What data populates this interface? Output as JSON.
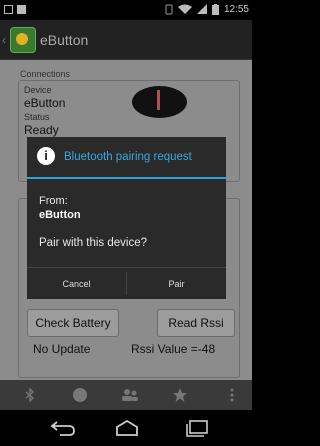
{
  "status_bar": {
    "time": "12:55"
  },
  "app": {
    "title": "eButton"
  },
  "connections": {
    "section_label": "Connections",
    "device_label": "Device",
    "device_value": "eButton",
    "status_label": "Status",
    "status_value": "Ready"
  },
  "actions": {
    "check_battery": "Check Battery",
    "read_rssi": "Read Rssi",
    "battery_status": "No Update",
    "rssi_value": "Rssi Value =-48"
  },
  "dialog": {
    "title": "Bluetooth pairing request",
    "from_label": "From:",
    "from_value": "eButton",
    "question": "Pair with this device?",
    "cancel": "Cancel",
    "pair": "Pair"
  },
  "colors": {
    "accent": "#2da3d8",
    "dialog_bg": "#2a2a2a",
    "content_bg": "#8c8c8c"
  },
  "icons": [
    "bluetooth-icon",
    "record-icon",
    "people-icon",
    "star-icon",
    "overflow-menu-icon",
    "back-icon",
    "home-icon",
    "recents-icon"
  ]
}
